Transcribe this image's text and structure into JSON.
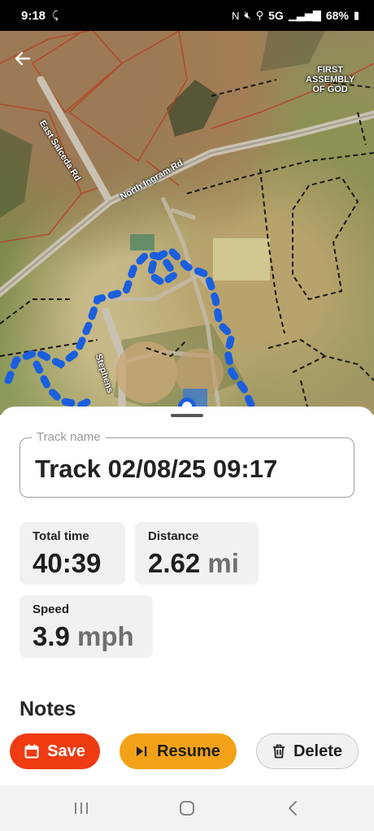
{
  "status_bar": {
    "time": "9:18",
    "network": "5G",
    "battery": "68%",
    "icons": [
      "missed-call-icon",
      "nfc-icon",
      "mute-icon",
      "location-icon",
      "signal-icon",
      "battery-icon"
    ]
  },
  "map": {
    "labels": {
      "east_salceda": "East Salceda Rd",
      "north_ingram": "North Ingram Rd",
      "stephens": "Stephens",
      "church_line1": "FIRST",
      "church_line2": "ASSEMBLY",
      "church_line3": "OF GOD"
    },
    "track_color": "#1a5fe0"
  },
  "track_name": {
    "label": "Track name",
    "value": "Track 02/08/25 09:17"
  },
  "stats": {
    "total_time": {
      "label": "Total time",
      "value": "40:39"
    },
    "distance": {
      "label": "Distance",
      "value": "2.62",
      "unit": "mi"
    },
    "speed": {
      "label": "Speed",
      "value": "3.9",
      "unit": "mph"
    }
  },
  "notes": {
    "heading": "Notes"
  },
  "actions": {
    "save_label": "Save",
    "resume_label": "Resume",
    "delete_label": "Delete"
  },
  "colors": {
    "save": "#ee3b12",
    "resume": "#f3a217",
    "delete": "#f1f1f1"
  }
}
